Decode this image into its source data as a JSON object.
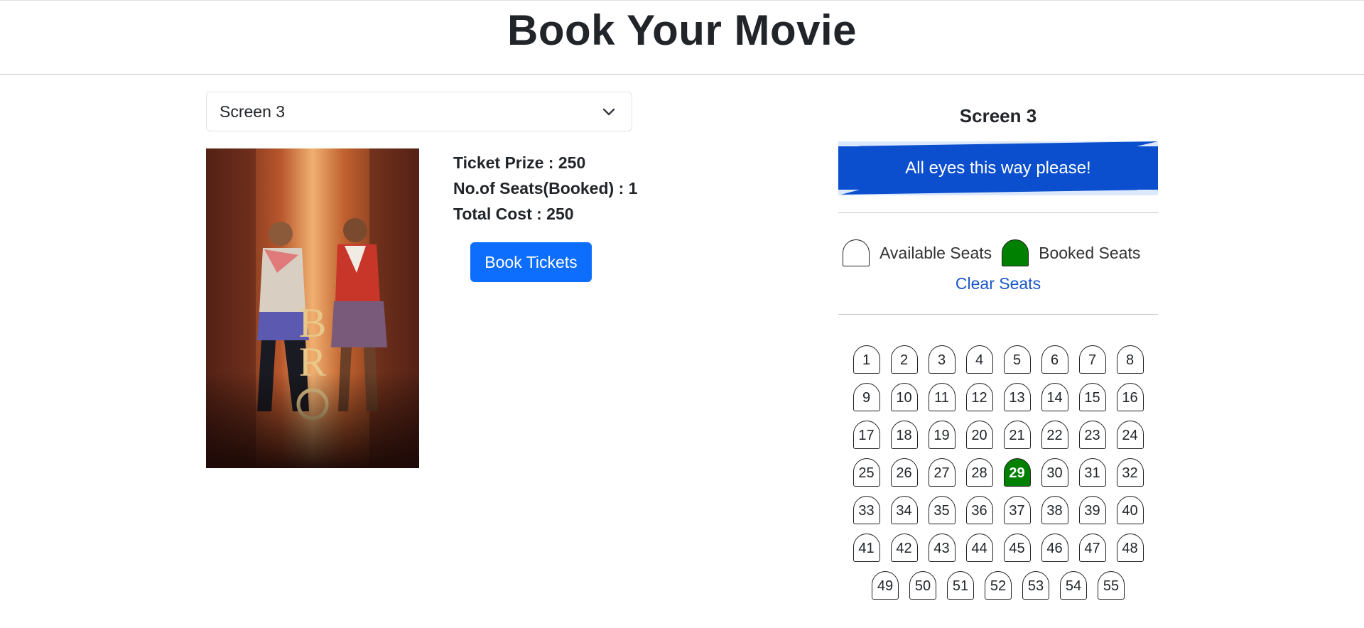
{
  "header": {
    "title": "Book Your Movie"
  },
  "screen_select": {
    "selected": "Screen 3"
  },
  "info": {
    "ticket_price": "Ticket Prize : 250",
    "seats_booked": "No.of Seats(Booked) : 1",
    "total_cost": "Total Cost : 250"
  },
  "book_button": {
    "label": "Book Tickets"
  },
  "screen_panel": {
    "label": "Screen 3",
    "banner": "All eyes this way please!",
    "legend_available": "Available Seats",
    "legend_booked": "Booked Seats",
    "clear_label": "Clear Seats"
  },
  "colors": {
    "primary": "#0d6efd",
    "banner": "#0b4fce",
    "booked": "#008000"
  },
  "seat_rows": [
    [
      "1",
      "2",
      "3",
      "4",
      "5",
      "6",
      "7",
      "8"
    ],
    [
      "9",
      "10",
      "11",
      "12",
      "13",
      "14",
      "15",
      "16"
    ],
    [
      "17",
      "18",
      "19",
      "20",
      "21",
      "22",
      "23",
      "24"
    ],
    [
      "25",
      "26",
      "27",
      "28",
      "29",
      "30",
      "31",
      "32"
    ],
    [
      "33",
      "34",
      "35",
      "36",
      "37",
      "38",
      "39",
      "40"
    ],
    [
      "41",
      "42",
      "43",
      "44",
      "45",
      "46",
      "47",
      "48"
    ],
    [
      "49",
      "50",
      "51",
      "52",
      "53",
      "54",
      "55"
    ]
  ],
  "booked_seats": [
    "29"
  ]
}
